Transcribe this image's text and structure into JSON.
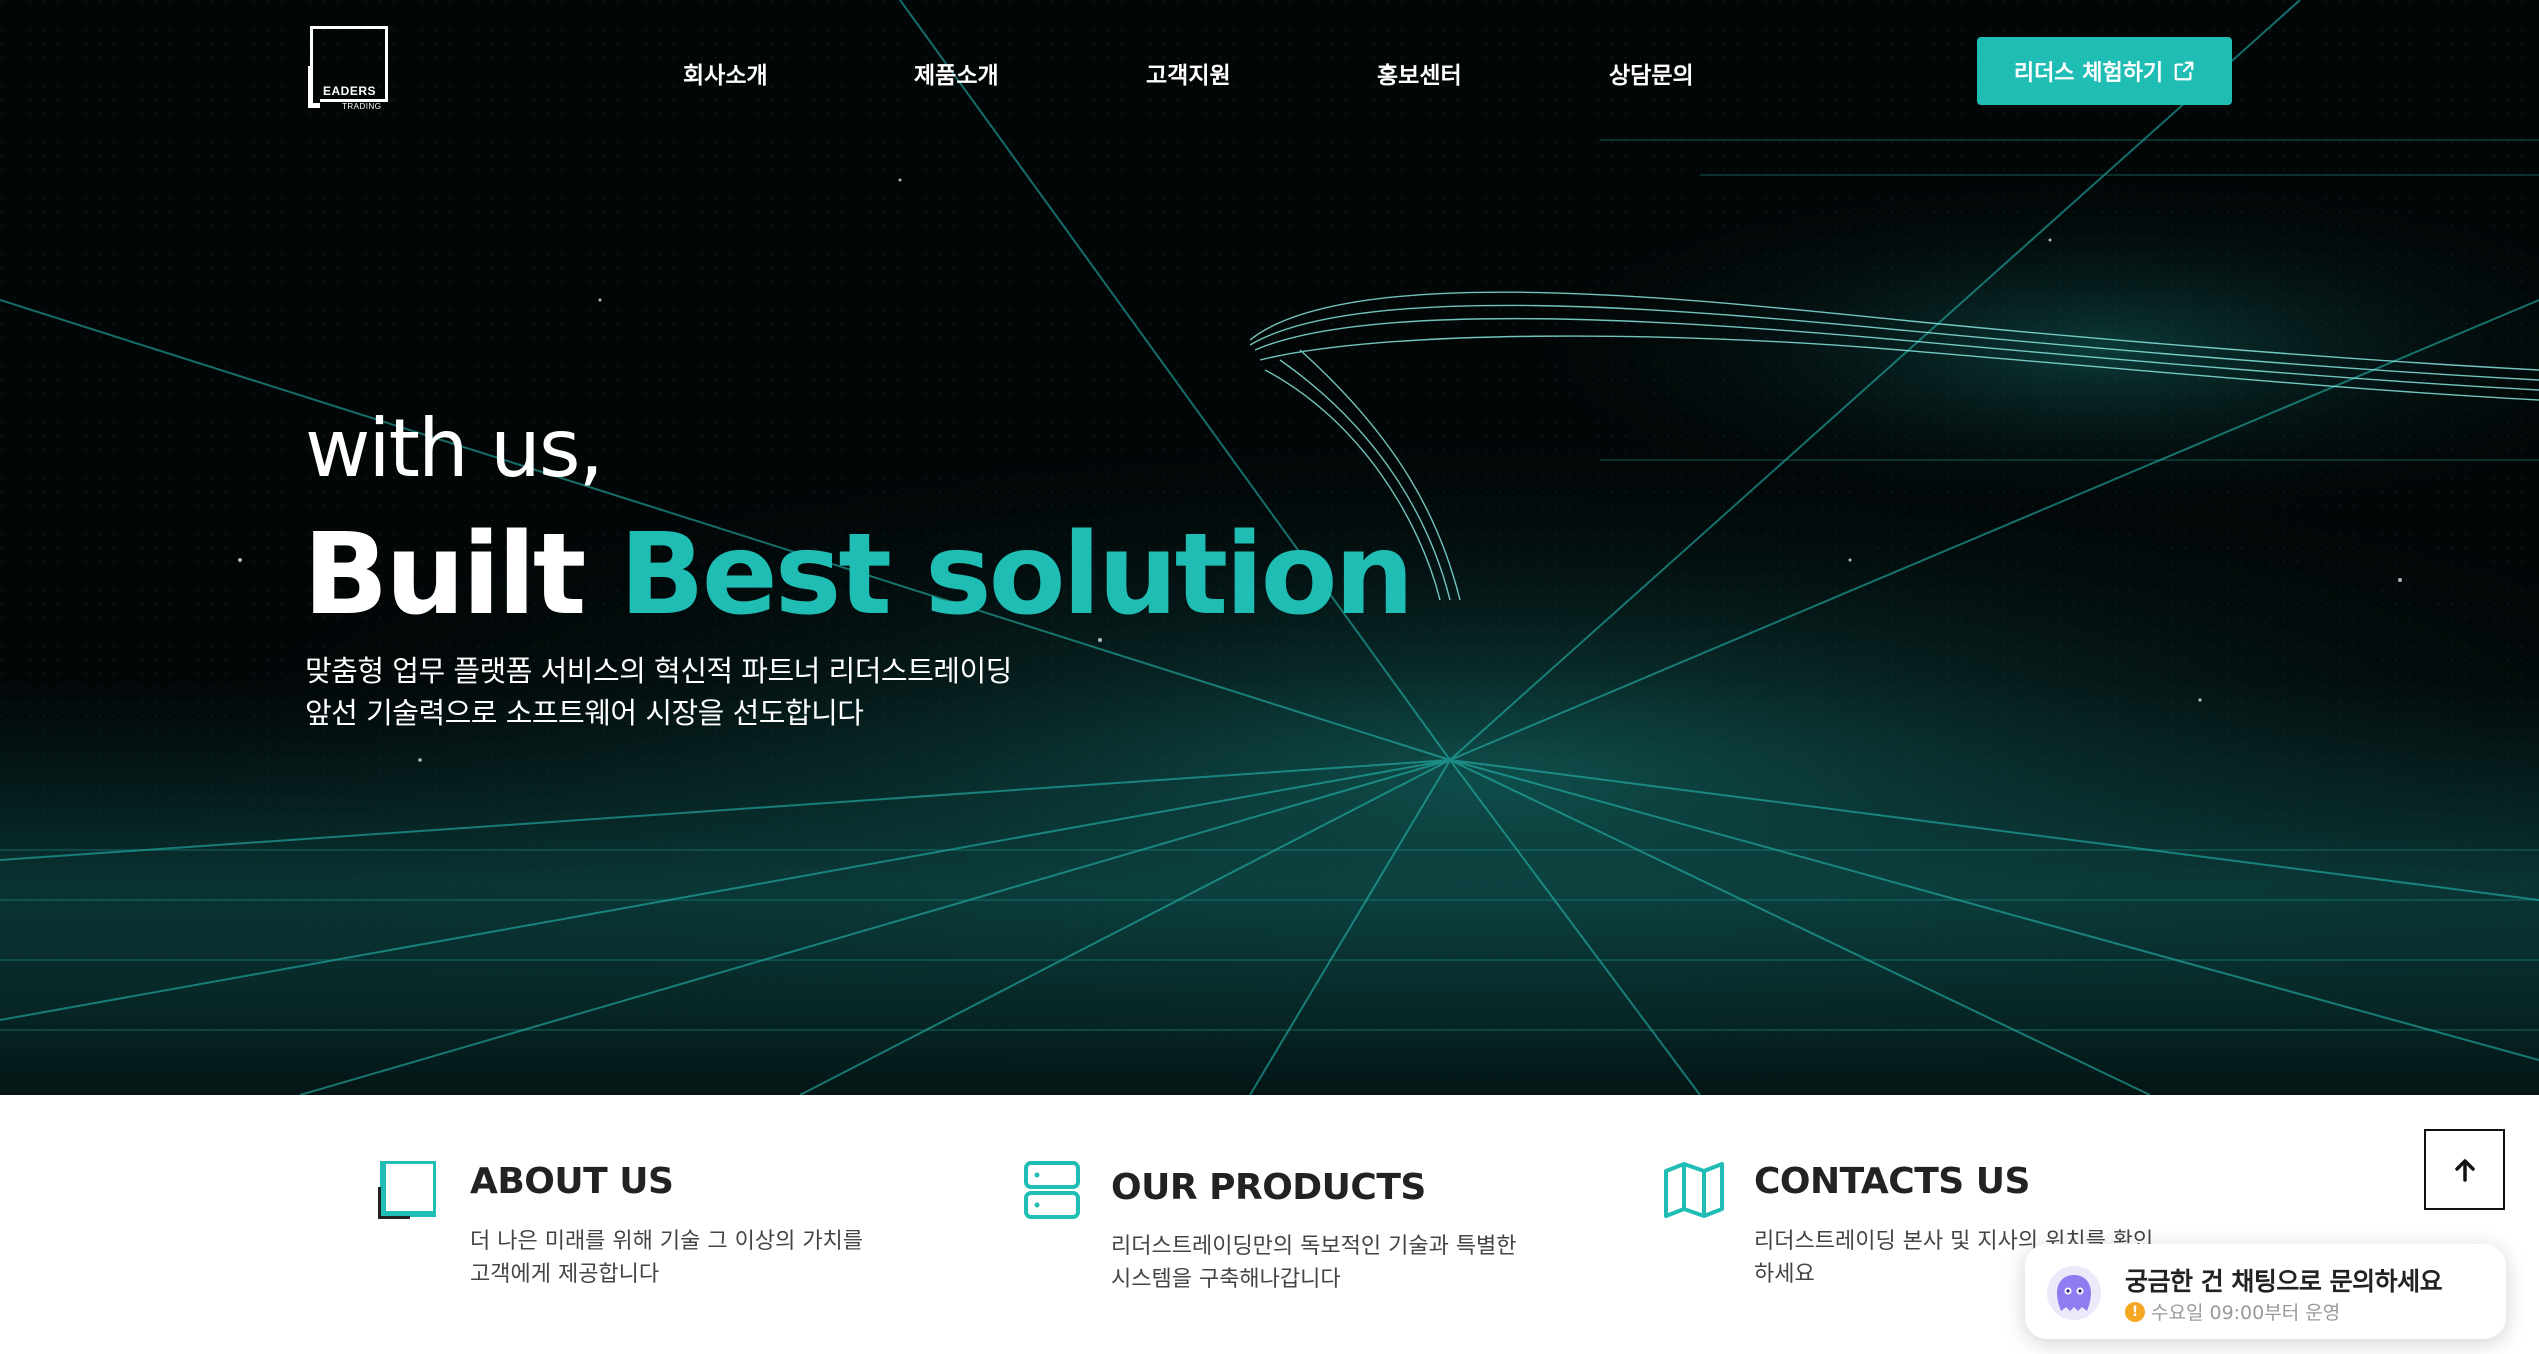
{
  "header": {
    "logo_text": "EADERS",
    "logo_subtext": "TRADING",
    "nav": [
      {
        "label": "회사소개"
      },
      {
        "label": "제품소개"
      },
      {
        "label": "고객지원"
      },
      {
        "label": "홍보센터"
      },
      {
        "label": "상담문의"
      }
    ],
    "cta_label": "리더스 체험하기",
    "cta_icon": "external-link-icon"
  },
  "hero": {
    "lead": "with us,",
    "title_white": "Built",
    "title_accent": "Best solution",
    "subtitle_line1": "맞춤형 업무 플랫폼 서비스의 혁신적 파트너 리더스트레이딩",
    "subtitle_line2": "앞선 기술력으로 소프트웨어 시장을 선도합니다"
  },
  "features": [
    {
      "icon": "square-frame-icon",
      "title": "ABOUT US",
      "line1": "더 나은 미래를 위해 기술 그 이상의 가치를",
      "line2": "고객에게 제공합니다"
    },
    {
      "icon": "server-icon",
      "title": "OUR PRODUCTS",
      "line1": "리더스트레이딩만의 독보적인 기술과 특별한",
      "line2": "시스템을 구축해나갑니다"
    },
    {
      "icon": "map-icon",
      "title": "CONTACTS US",
      "line1": "리더스트레이딩 본사 및 지사의 위치를 확인",
      "line2": "하세요"
    }
  ],
  "scroll_top_icon": "arrow-up-icon",
  "chat": {
    "title": "궁금한 건 채팅으로 문의하세요",
    "hours": "수요일 09:00부터 운영",
    "icon": "chat-bot-icon"
  },
  "colors": {
    "accent": "#1fbdb4",
    "hero_bg": "#020607",
    "text_dark": "#222222"
  }
}
